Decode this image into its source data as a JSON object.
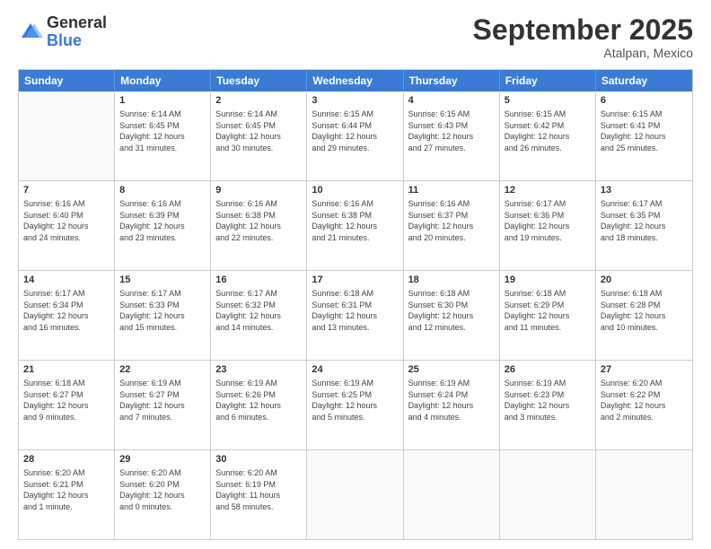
{
  "logo": {
    "general": "General",
    "blue": "Blue"
  },
  "header": {
    "month": "September 2025",
    "location": "Atalpan, Mexico"
  },
  "days": [
    "Sunday",
    "Monday",
    "Tuesday",
    "Wednesday",
    "Thursday",
    "Friday",
    "Saturday"
  ],
  "weeks": [
    [
      {
        "num": "",
        "info": ""
      },
      {
        "num": "1",
        "info": "Sunrise: 6:14 AM\nSunset: 6:45 PM\nDaylight: 12 hours\nand 31 minutes."
      },
      {
        "num": "2",
        "info": "Sunrise: 6:14 AM\nSunset: 6:45 PM\nDaylight: 12 hours\nand 30 minutes."
      },
      {
        "num": "3",
        "info": "Sunrise: 6:15 AM\nSunset: 6:44 PM\nDaylight: 12 hours\nand 29 minutes."
      },
      {
        "num": "4",
        "info": "Sunrise: 6:15 AM\nSunset: 6:43 PM\nDaylight: 12 hours\nand 27 minutes."
      },
      {
        "num": "5",
        "info": "Sunrise: 6:15 AM\nSunset: 6:42 PM\nDaylight: 12 hours\nand 26 minutes."
      },
      {
        "num": "6",
        "info": "Sunrise: 6:15 AM\nSunset: 6:41 PM\nDaylight: 12 hours\nand 25 minutes."
      }
    ],
    [
      {
        "num": "7",
        "info": "Sunrise: 6:16 AM\nSunset: 6:40 PM\nDaylight: 12 hours\nand 24 minutes."
      },
      {
        "num": "8",
        "info": "Sunrise: 6:16 AM\nSunset: 6:39 PM\nDaylight: 12 hours\nand 23 minutes."
      },
      {
        "num": "9",
        "info": "Sunrise: 6:16 AM\nSunset: 6:38 PM\nDaylight: 12 hours\nand 22 minutes."
      },
      {
        "num": "10",
        "info": "Sunrise: 6:16 AM\nSunset: 6:38 PM\nDaylight: 12 hours\nand 21 minutes."
      },
      {
        "num": "11",
        "info": "Sunrise: 6:16 AM\nSunset: 6:37 PM\nDaylight: 12 hours\nand 20 minutes."
      },
      {
        "num": "12",
        "info": "Sunrise: 6:17 AM\nSunset: 6:36 PM\nDaylight: 12 hours\nand 19 minutes."
      },
      {
        "num": "13",
        "info": "Sunrise: 6:17 AM\nSunset: 6:35 PM\nDaylight: 12 hours\nand 18 minutes."
      }
    ],
    [
      {
        "num": "14",
        "info": "Sunrise: 6:17 AM\nSunset: 6:34 PM\nDaylight: 12 hours\nand 16 minutes."
      },
      {
        "num": "15",
        "info": "Sunrise: 6:17 AM\nSunset: 6:33 PM\nDaylight: 12 hours\nand 15 minutes."
      },
      {
        "num": "16",
        "info": "Sunrise: 6:17 AM\nSunset: 6:32 PM\nDaylight: 12 hours\nand 14 minutes."
      },
      {
        "num": "17",
        "info": "Sunrise: 6:18 AM\nSunset: 6:31 PM\nDaylight: 12 hours\nand 13 minutes."
      },
      {
        "num": "18",
        "info": "Sunrise: 6:18 AM\nSunset: 6:30 PM\nDaylight: 12 hours\nand 12 minutes."
      },
      {
        "num": "19",
        "info": "Sunrise: 6:18 AM\nSunset: 6:29 PM\nDaylight: 12 hours\nand 11 minutes."
      },
      {
        "num": "20",
        "info": "Sunrise: 6:18 AM\nSunset: 6:28 PM\nDaylight: 12 hours\nand 10 minutes."
      }
    ],
    [
      {
        "num": "21",
        "info": "Sunrise: 6:18 AM\nSunset: 6:27 PM\nDaylight: 12 hours\nand 9 minutes."
      },
      {
        "num": "22",
        "info": "Sunrise: 6:19 AM\nSunset: 6:27 PM\nDaylight: 12 hours\nand 7 minutes."
      },
      {
        "num": "23",
        "info": "Sunrise: 6:19 AM\nSunset: 6:26 PM\nDaylight: 12 hours\nand 6 minutes."
      },
      {
        "num": "24",
        "info": "Sunrise: 6:19 AM\nSunset: 6:25 PM\nDaylight: 12 hours\nand 5 minutes."
      },
      {
        "num": "25",
        "info": "Sunrise: 6:19 AM\nSunset: 6:24 PM\nDaylight: 12 hours\nand 4 minutes."
      },
      {
        "num": "26",
        "info": "Sunrise: 6:19 AM\nSunset: 6:23 PM\nDaylight: 12 hours\nand 3 minutes."
      },
      {
        "num": "27",
        "info": "Sunrise: 6:20 AM\nSunset: 6:22 PM\nDaylight: 12 hours\nand 2 minutes."
      }
    ],
    [
      {
        "num": "28",
        "info": "Sunrise: 6:20 AM\nSunset: 6:21 PM\nDaylight: 12 hours\nand 1 minute."
      },
      {
        "num": "29",
        "info": "Sunrise: 6:20 AM\nSunset: 6:20 PM\nDaylight: 12 hours\nand 0 minutes."
      },
      {
        "num": "30",
        "info": "Sunrise: 6:20 AM\nSunset: 6:19 PM\nDaylight: 11 hours\nand 58 minutes."
      },
      {
        "num": "",
        "info": ""
      },
      {
        "num": "",
        "info": ""
      },
      {
        "num": "",
        "info": ""
      },
      {
        "num": "",
        "info": ""
      }
    ]
  ]
}
